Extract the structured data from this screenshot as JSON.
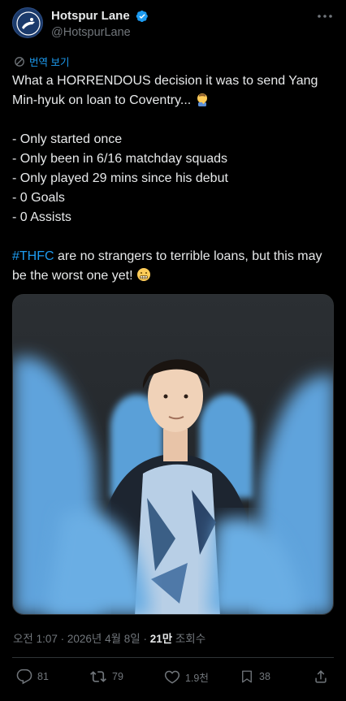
{
  "author": {
    "display_name": "Hotspur Lane",
    "handle": "@HotspurLane"
  },
  "translate_label": "번역 보기",
  "tweet": {
    "line1": "What a HORRENDOUS decision it was to send Yang Min-hyuk on loan to Coventry...",
    "bullets": [
      "- Only started once",
      "- Only been in 6/16 matchday squads",
      "- Only played 29 mins since his debut",
      "- 0 Goals",
      "- 0 Assists"
    ],
    "hashtag": "#THFC",
    "closing": " are no strangers to terrible loans, but this may be the worst one yet!"
  },
  "meta": {
    "time": "오전 1:07",
    "separator1": " · ",
    "date": "2026년 4월 8일",
    "separator2": " · ",
    "views_count": "21만",
    "views_label": " 조회수"
  },
  "actions": {
    "replies": "81",
    "reposts": "79",
    "likes": "1.9천",
    "bookmarks": "38"
  },
  "colors": {
    "accent": "#1d9bf0",
    "text": "#e7e9ea",
    "muted": "#71767b",
    "background": "#000000"
  },
  "icons": [
    "verified-badge-icon",
    "more-icon",
    "translate-icon",
    "reply-icon",
    "repost-icon",
    "like-icon",
    "bookmark-icon",
    "share-icon"
  ]
}
